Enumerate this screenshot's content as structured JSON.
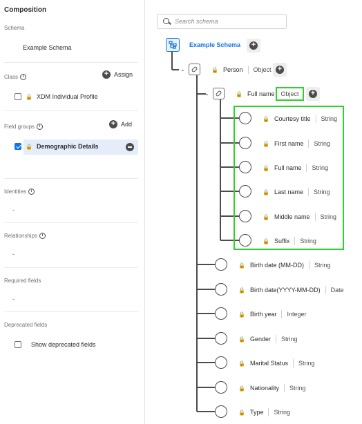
{
  "composition": {
    "title": "Composition",
    "schema_label": "Schema",
    "schema_name": "Example Schema",
    "class_label": "Class",
    "assign_label": "Assign",
    "class_item": "XDM Individual Profile",
    "field_groups_label": "Field groups",
    "add_label": "Add",
    "field_group_item": "Demographic Details",
    "identities_label": "Identities",
    "identities_value": "-",
    "relationships_label": "Relationships",
    "relationships_value": "-",
    "required_label": "Required fields",
    "required_value": "-",
    "deprecated_label": "Deprecated fields",
    "show_deprecated_label": "Show deprecated fields"
  },
  "tree": {
    "search_placeholder": "Search schema",
    "root_label": "Example Schema",
    "person": {
      "name": "Person",
      "type": "Object"
    },
    "full_name": {
      "name": "Full name",
      "type": "Object"
    },
    "full_name_children": [
      {
        "name": "Courtesy title",
        "type": "String"
      },
      {
        "name": "First name",
        "type": "String"
      },
      {
        "name": "Full name",
        "type": "String"
      },
      {
        "name": "Last name",
        "type": "String"
      },
      {
        "name": "Middle name",
        "type": "String"
      },
      {
        "name": "Suffix",
        "type": "String"
      }
    ],
    "person_children": [
      {
        "name": "Birth date (MM-DD)",
        "type": "String"
      },
      {
        "name": "Birth date(YYYY-MM-DD)",
        "type": "Date"
      },
      {
        "name": "Birth year",
        "type": "Integer"
      },
      {
        "name": "Gender",
        "type": "String"
      },
      {
        "name": "Marital Status",
        "type": "String"
      },
      {
        "name": "Nationality",
        "type": "String"
      },
      {
        "name": "Type",
        "type": "String"
      }
    ]
  },
  "colors": {
    "accent": "#1473e6",
    "highlight": "#2ed02e",
    "selected_bg": "#e4edf9"
  },
  "icons": {
    "search": "search-icon",
    "lock": "lock-icon",
    "add": "plus-circle-icon",
    "remove": "minus-circle-icon",
    "info": "info-icon",
    "link": "link-icon",
    "schema": "schema-icon",
    "expand": "chevron-down-icon"
  }
}
